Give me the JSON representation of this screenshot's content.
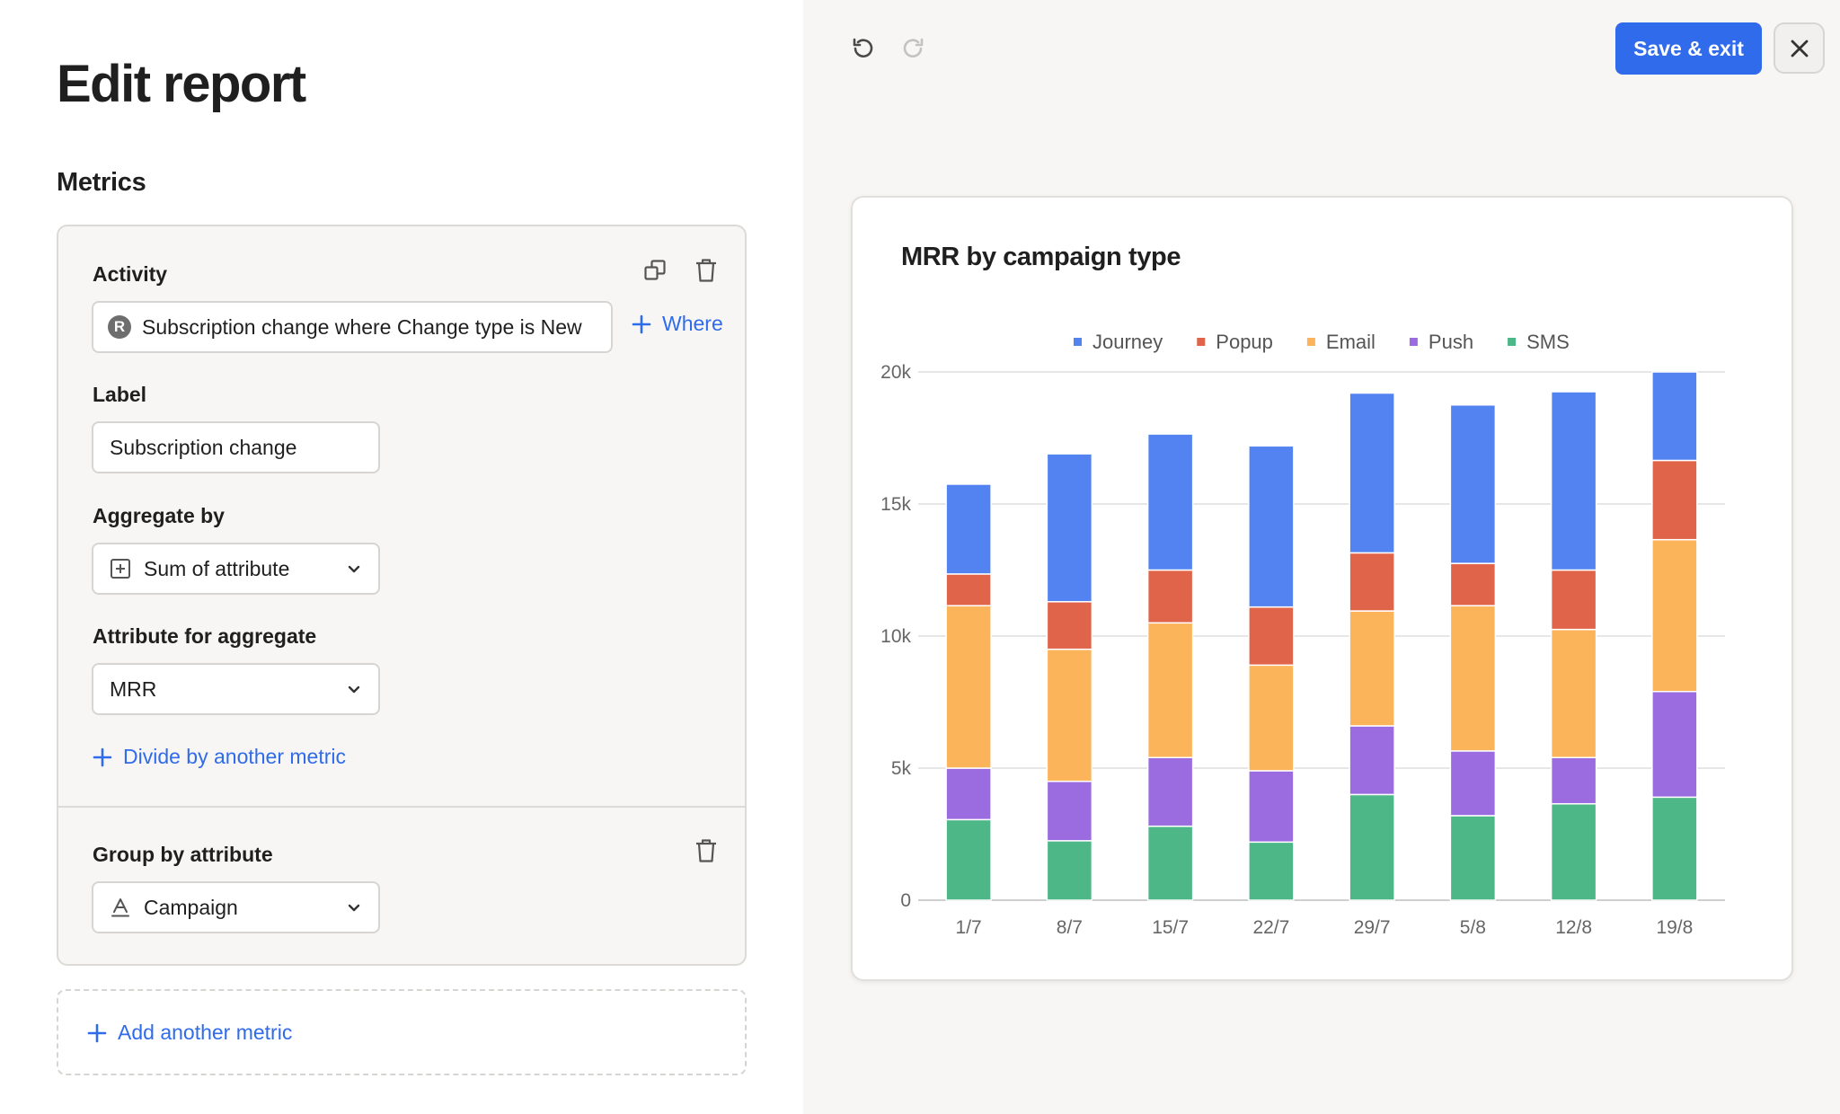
{
  "page": {
    "title": "Edit report",
    "metrics_heading": "Metrics"
  },
  "metric": {
    "activity_label": "Activity",
    "activity_badge": "R",
    "activity_value": "Subscription change where Change type is New",
    "where_link": "Where",
    "label_label": "Label",
    "label_value": "Subscription change",
    "aggregate_label": "Aggregate by",
    "aggregate_value": "Sum of attribute",
    "attribute_label": "Attribute for aggregate",
    "attribute_value": "MRR",
    "divide_link": "Divide by another metric",
    "group_label": "Group by attribute",
    "group_value": "Campaign"
  },
  "add_metric_link": "Add another metric",
  "toolbar": {
    "save_label": "Save & exit"
  },
  "icons": {
    "undo": "undo-icon",
    "redo": "redo-icon",
    "close": "close-icon",
    "duplicate": "duplicate-icon",
    "delete": "trash-icon",
    "plus": "plus-icon",
    "chevron": "chevron-down-icon",
    "sum": "sum-icon",
    "text_attribute": "text-attribute-icon"
  },
  "colors": {
    "accent": "#2f6bea",
    "journey": "#5383f0",
    "popup": "#e0644a",
    "email": "#fbb45a",
    "push": "#9a6ce0",
    "sms": "#4db788"
  },
  "chart_data": {
    "type": "bar",
    "stacked": true,
    "title": "MRR by campaign type",
    "categories": [
      "1/7",
      "8/7",
      "15/7",
      "22/7",
      "29/7",
      "5/8",
      "12/8",
      "19/8"
    ],
    "series": [
      {
        "name": "SMS",
        "values": [
          3050,
          2250,
          2800,
          2200,
          4000,
          3200,
          3650,
          3900
        ]
      },
      {
        "name": "Push",
        "values": [
          1950,
          2250,
          2600,
          2700,
          2600,
          2450,
          1750,
          4000
        ]
      },
      {
        "name": "Email",
        "values": [
          6150,
          5000,
          5100,
          4000,
          4350,
          5500,
          4850,
          5750
        ]
      },
      {
        "name": "Popup",
        "values": [
          1200,
          1800,
          2000,
          2200,
          2200,
          1600,
          2250,
          3000
        ]
      },
      {
        "name": "Journey",
        "values": [
          3400,
          5600,
          5150,
          6100,
          6050,
          6000,
          6750,
          3350
        ]
      }
    ],
    "legend_order": [
      "Journey",
      "Popup",
      "Email",
      "Push",
      "SMS"
    ],
    "y_ticks": [
      "0",
      "5k",
      "10k",
      "15k",
      "20k"
    ],
    "ylim": [
      0,
      20000
    ],
    "grid": true,
    "legend_position": "top"
  }
}
